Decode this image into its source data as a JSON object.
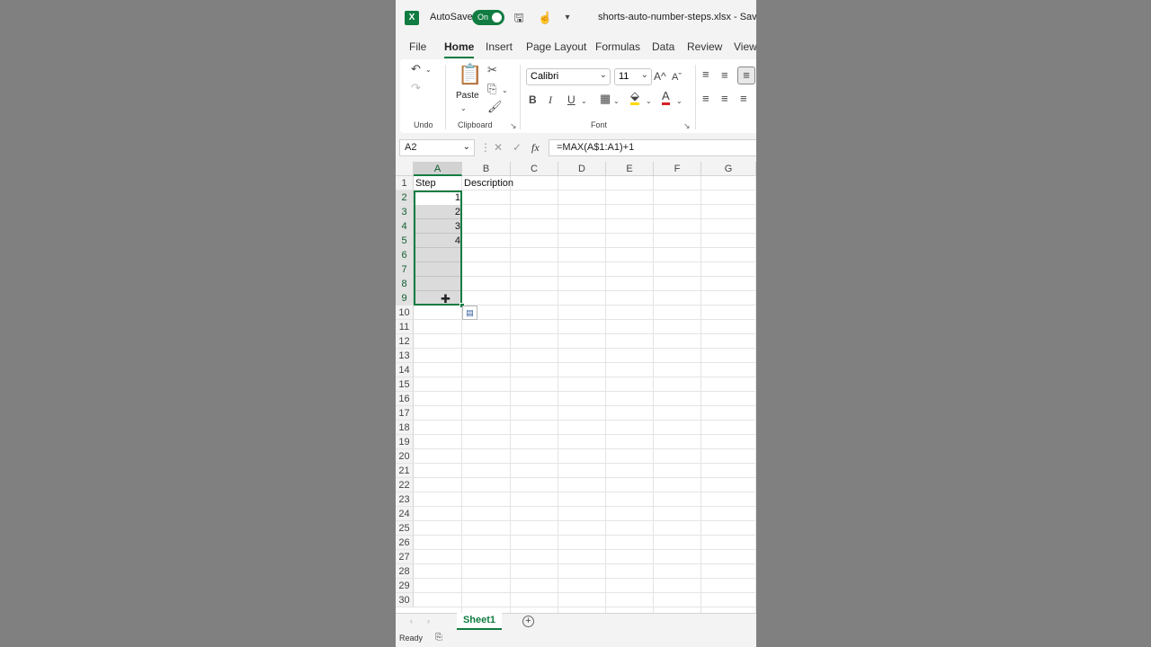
{
  "titlebar": {
    "logo": "X",
    "autosave_label": "AutoSave",
    "autosave_state": "On",
    "filename": "shorts-auto-number-steps.xlsx  -  Saved",
    "icons": [
      "save-icon",
      "touch-mode-icon",
      "customize-qat-icon"
    ]
  },
  "tabs": [
    "File",
    "Home",
    "Insert",
    "Page Layout",
    "Formulas",
    "Data",
    "Review",
    "View"
  ],
  "active_tab": "Home",
  "ribbon": {
    "undo_group": "Undo",
    "clipboard_group": "Clipboard",
    "font_group": "Font",
    "paste_label": "Paste",
    "font_name": "Calibri",
    "font_size": "11",
    "bold": "B",
    "italic": "I",
    "underline": "U",
    "font_color_glyph": "A",
    "grow_glyph": "A^",
    "shrink_glyph": "Aˇ"
  },
  "formula_bar": {
    "name_box": "A2",
    "fx": "fx",
    "formula": "=MAX(A$1:A1)+1"
  },
  "sheet": {
    "columns": [
      "A",
      "B",
      "C",
      "D",
      "E",
      "F",
      "G"
    ],
    "row_count": 30,
    "header_row": [
      "Step",
      "Description"
    ],
    "step_values": [
      "1",
      "2",
      "3",
      "4"
    ],
    "selected_range": "A2:A9",
    "colors": {
      "accent": "#107c41",
      "selection": "#d9d9d9"
    }
  },
  "sheet_tabs": [
    "Sheet1"
  ],
  "status": {
    "text": "Ready"
  }
}
